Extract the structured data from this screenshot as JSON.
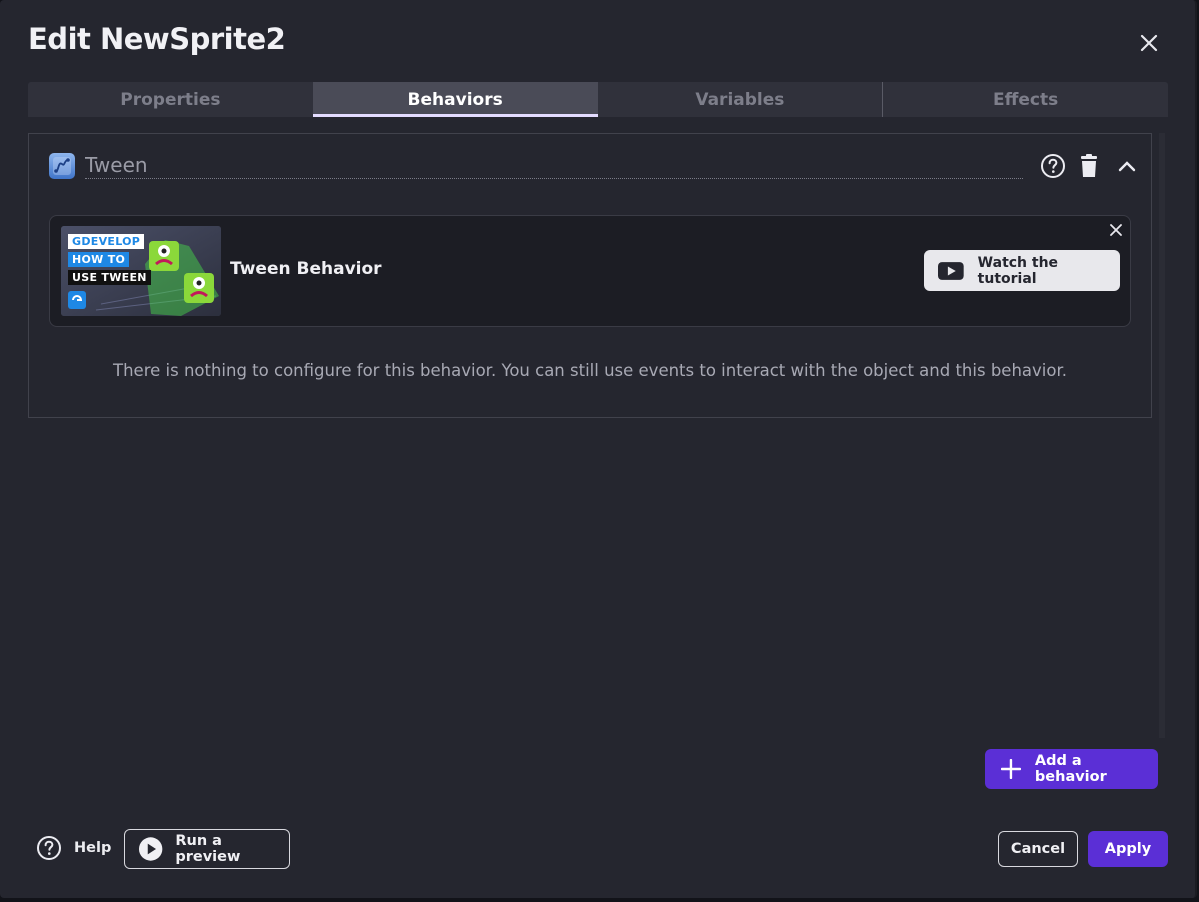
{
  "dialog": {
    "title": "Edit NewSprite2"
  },
  "tabs": [
    {
      "label": "Properties",
      "active": false
    },
    {
      "label": "Behaviors",
      "active": true
    },
    {
      "label": "Variables",
      "active": false
    },
    {
      "label": "Effects",
      "active": false
    }
  ],
  "behavior": {
    "name": "Tween",
    "icon": "tween-behavior-icon",
    "header_icons": [
      "help-circle-icon",
      "trash-icon",
      "chevron-up-icon"
    ],
    "tutorial": {
      "title": "Tween Behavior",
      "thumbnail_lines": [
        "GDEVELOP",
        "HOW TO",
        "USE TWEEN"
      ],
      "watch_label": "Watch the tutorial"
    },
    "empty_message": "There is nothing to configure for this behavior. You can still use events to interact with the object and this behavior."
  },
  "actions": {
    "add_behavior": "Add a behavior",
    "help": "Help",
    "run_preview": "Run a preview",
    "cancel": "Cancel",
    "apply": "Apply"
  },
  "colors": {
    "background": "#25262f",
    "primary": "#5b2fd6",
    "tab_active": "#4a4b57",
    "tab_indicator": "#e4dcff"
  }
}
